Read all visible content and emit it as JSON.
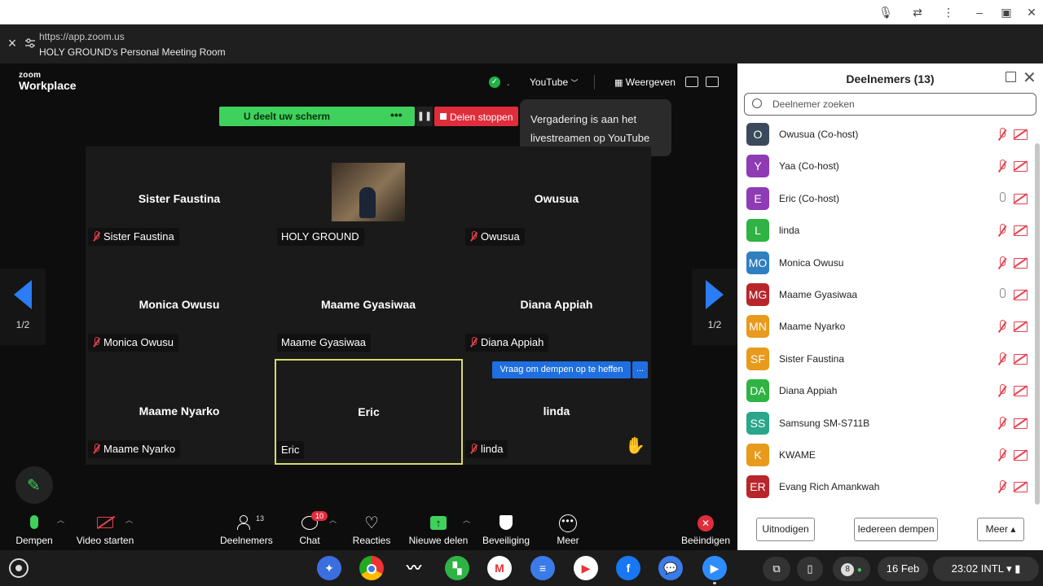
{
  "browser": {
    "url": "https://app.zoom.us",
    "title": "HOLY GROUND's Personal Meeting Room"
  },
  "zoom": {
    "logo_small": "zoom",
    "logo_big": "Workplace",
    "youtube_label": "YouTube",
    "view_label": "Weergeven",
    "share_status": "U deelt uw scherm",
    "share_more": "•••",
    "pause": "❚❚",
    "stop_share": "Delen stoppen",
    "tooltip": "Vergadering is aan het livestreamen op YouTube",
    "page_left": "1/2",
    "page_right": "1/2",
    "ask_unmute": "Vraag om dempen op te heffen",
    "ask_more": "...",
    "tiles": [
      {
        "name": "Sister Faustina",
        "tag": "Sister Faustina",
        "muted": true
      },
      {
        "name": "",
        "tag": "HOLY GROUND",
        "muted": false
      },
      {
        "name": "Owusua",
        "tag": "Owusua",
        "muted": true
      },
      {
        "name": "Monica Owusu",
        "tag": "Monica Owusu",
        "muted": true
      },
      {
        "name": "Maame Gyasiwaa",
        "tag": "Maame Gyasiwaa",
        "muted": false
      },
      {
        "name": "Diana Appiah",
        "tag": "Diana Appiah",
        "muted": true
      },
      {
        "name": "Maame Nyarko",
        "tag": "Maame Nyarko",
        "muted": true
      },
      {
        "name": "Eric",
        "tag": "Eric",
        "muted": false
      },
      {
        "name": "linda",
        "tag": "linda",
        "muted": true
      }
    ],
    "toolbar": {
      "mute": "Dempen",
      "video": "Video starten",
      "participants": "Deelnemers",
      "participants_count": "13",
      "chat": "Chat",
      "chat_badge": "10",
      "reactions": "Reacties",
      "new_share": "Nieuwe delen",
      "security": "Beveiliging",
      "more": "Meer",
      "end": "Beëindigen"
    }
  },
  "panel": {
    "title": "Deelnemers (13)",
    "search_placeholder": "Deelnemer zoeken",
    "participants": [
      {
        "initials": "O",
        "name": "Owusua (Co-host)",
        "color": "#3a4a5c",
        "mic": "off"
      },
      {
        "initials": "Y",
        "name": "Yaa (Co-host)",
        "color": "#8e3bb5",
        "mic": "off"
      },
      {
        "initials": "E",
        "name": "Eric (Co-host)",
        "color": "#8e3bb5",
        "mic": "on"
      },
      {
        "initials": "L",
        "name": "linda",
        "color": "#2fb344",
        "mic": "off"
      },
      {
        "initials": "MO",
        "name": "Monica Owusu",
        "color": "#2f7fc1",
        "mic": "off"
      },
      {
        "initials": "MG",
        "name": "Maame Gyasiwaa",
        "color": "#b8262b",
        "mic": "on"
      },
      {
        "initials": "MN",
        "name": "Maame Nyarko",
        "color": "#e89a1c",
        "mic": "off"
      },
      {
        "initials": "SF",
        "name": "Sister Faustina",
        "color": "#e89a1c",
        "mic": "off"
      },
      {
        "initials": "DA",
        "name": "Diana Appiah",
        "color": "#2fb344",
        "mic": "off"
      },
      {
        "initials": "SS",
        "name": "Samsung SM-S711B",
        "color": "#2aa68a",
        "mic": "off"
      },
      {
        "initials": "K",
        "name": "KWAME",
        "color": "#e89a1c",
        "mic": "off"
      },
      {
        "initials": "ER",
        "name": "Evang Rich Amankwah",
        "color": "#b8262b",
        "mic": "off"
      }
    ],
    "invite": "Uitnodigen",
    "mute_all": "Iedereen dempen",
    "more": "Meer ▴"
  },
  "shelf": {
    "date": "16 Feb",
    "time": "23:02",
    "locale": "INTL",
    "notif_count": "8"
  }
}
